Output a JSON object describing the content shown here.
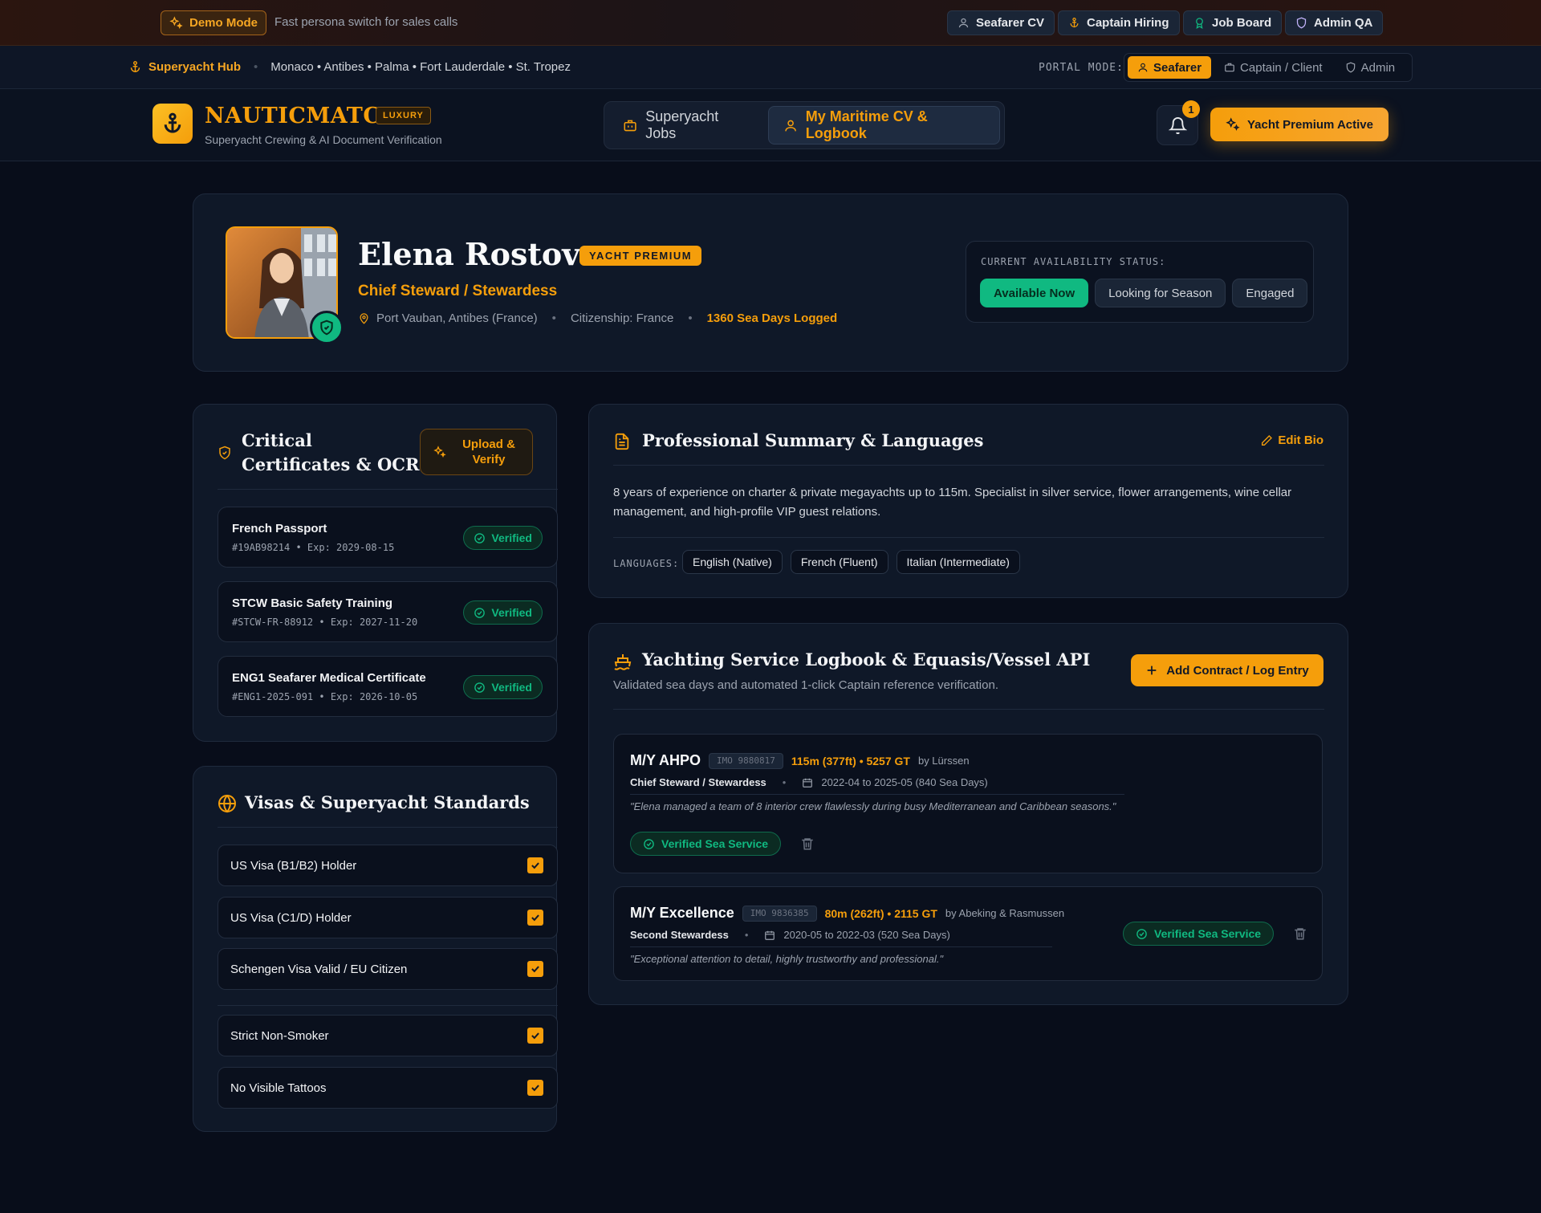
{
  "demo": {
    "label": "Demo Mode",
    "description": "Fast persona switch for sales calls",
    "personas": [
      "Seafarer CV",
      "Captain Hiring",
      "Job Board",
      "Admin QA"
    ]
  },
  "hub": {
    "title": "Superyacht Hub",
    "ports": "Monaco • Antibes • Palma • Fort Lauderdale • St. Tropez",
    "portal_mode_label": "PORTAL MODE:",
    "modes": [
      "Seafarer",
      "Captain / Client",
      "Admin"
    ],
    "active_mode": "Seafarer"
  },
  "header": {
    "brand": "NAUTICMATCH",
    "brand_badge": "LUXURY",
    "tagline": "Superyacht Crewing & AI Document Verification",
    "nav": [
      "Superyacht Jobs",
      "My Maritime CV & Logbook"
    ],
    "active_nav": "My Maritime CV & Logbook",
    "notifications": "1",
    "premium_label": "Yacht Premium Active"
  },
  "profile": {
    "name": "Elena Rostova",
    "badge": "YACHT PREMIUM",
    "role": "Chief Steward / Stewardess",
    "location": "Port Vauban, Antibes (France)",
    "citizenship": "Citizenship: France",
    "sea_days": "1360 Sea Days Logged",
    "availability_label": "CURRENT AVAILABILITY STATUS:",
    "availability_options": [
      "Available Now",
      "Looking for Season",
      "Engaged"
    ],
    "availability_selected": "Available Now"
  },
  "certificates": {
    "title": "Critical Certificates & OCR",
    "upload_label": "Upload & Verify",
    "items": [
      {
        "name": "French Passport",
        "id": "#19AB98214 • Exp: 2029-08-15",
        "status": "Verified"
      },
      {
        "name": "STCW Basic Safety Training",
        "id": "#STCW-FR-88912 • Exp: 2027-11-20",
        "status": "Verified"
      },
      {
        "name": "ENG1 Seafarer Medical Certificate",
        "id": "#ENG1-2025-091 • Exp: 2026-10-05",
        "status": "Verified"
      }
    ]
  },
  "visas": {
    "title": "Visas & Superyacht Standards",
    "items": [
      {
        "label": "US Visa (B1/B2) Holder",
        "checked": true
      },
      {
        "label": "US Visa (C1/D) Holder",
        "checked": true
      },
      {
        "label": "Schengen Visa Valid / EU Citizen",
        "checked": true
      },
      {
        "label": "Strict Non-Smoker",
        "checked": true
      },
      {
        "label": "No Visible Tattoos",
        "checked": true
      }
    ]
  },
  "summary": {
    "title": "Professional Summary & Languages",
    "edit_label": "Edit Bio",
    "text": "8 years of experience on charter & private megayachts up to 115m. Specialist in silver service, flower arrangements, wine cellar management, and high-profile VIP guest relations.",
    "languages_label": "LANGUAGES:",
    "languages": [
      "English (Native)",
      "French (Fluent)",
      "Italian (Intermediate)"
    ]
  },
  "logbook": {
    "title": "Yachting Service Logbook & Equasis/Vessel API",
    "subtitle": "Validated sea days and automated 1-click Captain reference verification.",
    "add_label": "Add Contract / Log Entry",
    "entries": [
      {
        "vessel": "M/Y AHPO",
        "imo": "IMO 9880817",
        "size": "115m (377ft) • 5257 GT",
        "builder": "by Lürssen",
        "role": "Chief Steward / Stewardess",
        "dates": "2022-04 to 2025-05 (840 Sea Days)",
        "quote": "\"Elena managed a team of 8 interior crew flawlessly during busy Mediterranean and Caribbean seasons.\"",
        "status": "Verified Sea Service"
      },
      {
        "vessel": "M/Y Excellence",
        "imo": "IMO 9836385",
        "size": "80m (262ft) • 2115 GT",
        "builder": "by Abeking & Rasmussen",
        "role": "Second Stewardess",
        "dates": "2020-05 to 2022-03 (520 Sea Days)",
        "quote": "\"Exceptional attention to detail, highly trustworthy and professional.\"",
        "status": "Verified Sea Service"
      }
    ]
  },
  "colors": {
    "accent": "#f59e0b",
    "success": "#10b981",
    "background": "#080d1a",
    "card": "#0f1828"
  }
}
